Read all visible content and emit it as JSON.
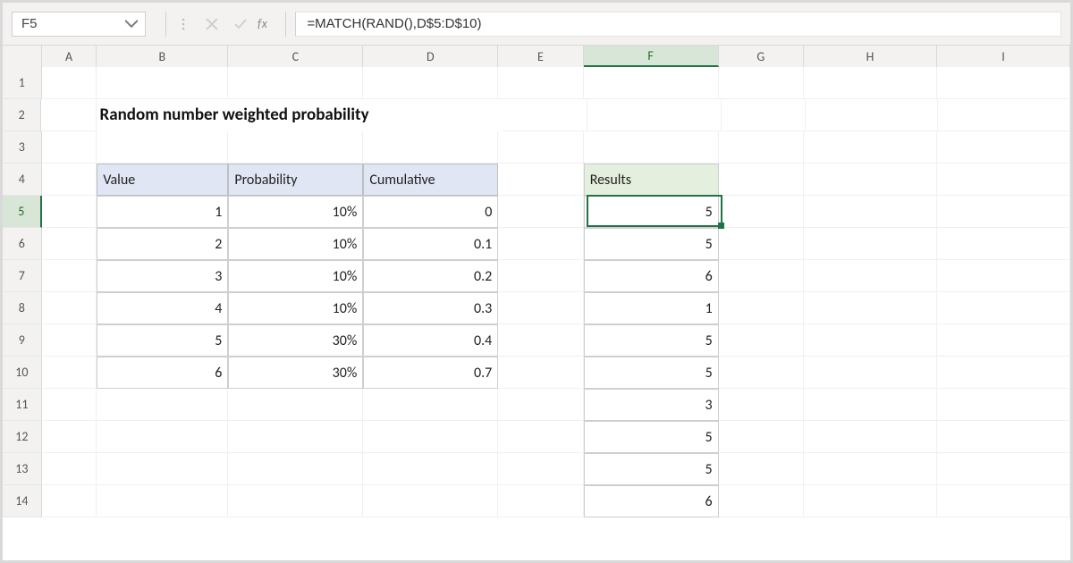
{
  "formula_bar": {
    "cell_ref": "F5",
    "formula": "=MATCH(RAND(),D$5:D$10)",
    "fx_label": "fx"
  },
  "columns": [
    "A",
    "B",
    "C",
    "D",
    "E",
    "F",
    "G",
    "H",
    "I"
  ],
  "active_column": "F",
  "active_row": 5,
  "row_numbers": [
    "1",
    "2",
    "3",
    "4",
    "5",
    "6",
    "7",
    "8",
    "9",
    "10",
    "11",
    "12",
    "13",
    "14"
  ],
  "title": "Random number weighted probability",
  "headers": {
    "value": "Value",
    "probability": "Probability",
    "cumulative": "Cumulative",
    "results": "Results"
  },
  "table_rows": [
    {
      "value": "1",
      "probability": "10%",
      "cumulative": "0"
    },
    {
      "value": "2",
      "probability": "10%",
      "cumulative": "0.1"
    },
    {
      "value": "3",
      "probability": "10%",
      "cumulative": "0.2"
    },
    {
      "value": "4",
      "probability": "10%",
      "cumulative": "0.3"
    },
    {
      "value": "5",
      "probability": "30%",
      "cumulative": "0.4"
    },
    {
      "value": "6",
      "probability": "30%",
      "cumulative": "0.7"
    }
  ],
  "results": [
    "5",
    "5",
    "6",
    "1",
    "5",
    "5",
    "3",
    "5",
    "5",
    "6"
  ]
}
